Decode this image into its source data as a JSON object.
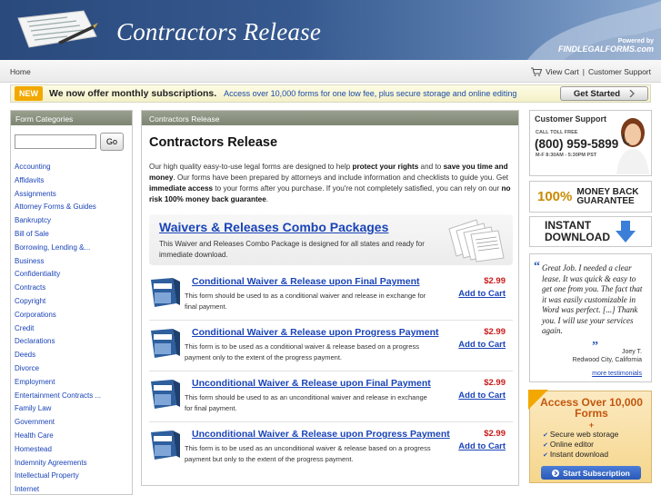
{
  "header": {
    "title": "Contractors Release",
    "powered_by": "Powered by",
    "brand": "FINDLEGALFORMS.com"
  },
  "nav": {
    "home": "Home",
    "view_cart": "View Cart",
    "separator": "|",
    "customer_support": "Customer Support"
  },
  "promo": {
    "badge": "NEW",
    "message": "We now offer monthly subscriptions.",
    "sub": "Access over 10,000 forms for one low fee, plus secure storage and online editing",
    "button": "Get Started"
  },
  "sidebar": {
    "heading": "Form Categories",
    "search_button": "Go",
    "search_value": "",
    "categories": [
      "Accounting",
      "Affidavits",
      "Assignments",
      "Attorney Forms & Guides",
      "Bankruptcy",
      "Bill of Sale",
      "Borrowing, Lending &...",
      "Business",
      "Confidentiality",
      "Contracts",
      "Copyright",
      "Corporations",
      "Credit",
      "Declarations",
      "Deeds",
      "Divorce",
      "Employment",
      "Entertainment Contracts ...",
      "Family Law",
      "Government",
      "Health Care",
      "Homestead",
      "Indemnity Agreements",
      "Intellectual Property",
      "Internet"
    ]
  },
  "main": {
    "breadcrumb": "Contractors Release",
    "heading": "Contractors Release",
    "intro": {
      "p1": "Our high quality easy-to-use legal forms are designed to help ",
      "b1": "protect your rights",
      "p2": " and to ",
      "b2": "save you time and money",
      "p3": ". Our forms have been prepared by attorneys and include information and checklists to guide you. Get ",
      "b3": "immediate access",
      "p4": " to your forms after you purchase. If you're not completely satisfied, you can rely on our ",
      "b4": "no risk 100% money back guarantee",
      "p5": "."
    },
    "combo": {
      "title": "Waivers & Releases Combo Packages",
      "description": "This Waiver and Releases Combo Package is designed for all states and ready for immediate download."
    },
    "products": [
      {
        "name": "Conditional Waiver & Release upon Final Payment",
        "description": "This form should be used to as a conditional waiver and release in exchange for final payment.",
        "price": "$2.99",
        "add": "Add to Cart"
      },
      {
        "name": "Conditional Waiver & Release upon Progress Payment",
        "description": "This form is to be used as a conditional waiver & release based on a progress payment only to the extent of the progress payment.",
        "price": "$2.99",
        "add": "Add to Cart"
      },
      {
        "name": "Unconditional Waiver & Release upon Final Payment",
        "description": "This form should be used to as an unconditional waiver and release in exchange for final payment.",
        "price": "$2.99",
        "add": "Add to Cart"
      },
      {
        "name": "Unconditional Waiver & Release upon Progress Payment",
        "description": "This form is to be used as an unconditional waiver & release based on a progress payment but only to the extent of the progress payment.",
        "price": "$2.99",
        "add": "Add to Cart"
      }
    ]
  },
  "right": {
    "support": {
      "title": "Customer Support",
      "toll_free": "CALL TOLL FREE",
      "phone": "(800) 959-5899",
      "hours": "M-F 8:30AM - 5:30PM PST"
    },
    "guarantee": {
      "pct": "100%",
      "line1": "MONEY BACK",
      "line2": "GUARANTEE"
    },
    "instant": {
      "line1": "INSTANT",
      "line2": "DOWNLOAD"
    },
    "testimonial": {
      "quote": "Great Job. I needed a clear lease. It was quick & easy to get one from you. The fact that it was easily customizable in Word was perfect. [...] Thank you. I will use your services again.",
      "author": "Joey T.",
      "location": "Redwood City, California",
      "more": "more testimonials"
    },
    "access": {
      "title": "Access Over 10,000 Forms",
      "plus": "+",
      "features": [
        "Secure web storage",
        "Online editor",
        "Instant download"
      ],
      "button": "Start Subscription"
    }
  },
  "colors": {
    "header": "#2a4a7d",
    "link": "#1a44b8",
    "price": "#c81a1a",
    "panel_head": "#8a917e",
    "promo_badge": "#f2a800",
    "access_title": "#c2570f"
  }
}
